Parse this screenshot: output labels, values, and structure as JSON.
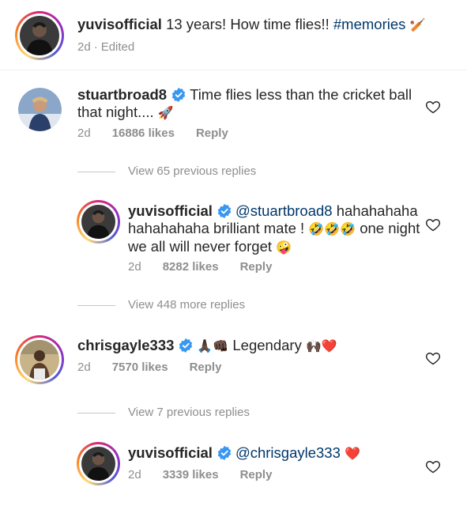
{
  "caption": {
    "username": "yuvisofficial",
    "text": "13 years! How time flies!!",
    "hashtag": "#memories",
    "emoji": "🏏",
    "time": "2d",
    "edited": "Edited"
  },
  "comments": [
    {
      "username": "stuartbroad8",
      "verified": true,
      "text": "Time flies less than the cricket ball that night....",
      "emoji": "🚀",
      "time": "2d",
      "likes": "16886 likes",
      "reply": "Reply"
    },
    {
      "username": "chrisgayle333",
      "verified": true,
      "emoji_lead": "🙏🏿👊🏿",
      "text": "Legendary",
      "emoji_trail": "🙌🏿❤️",
      "time": "2d",
      "likes": "7570 likes",
      "reply": "Reply"
    }
  ],
  "view_replies": {
    "first_previous": "View 65 previous replies",
    "first_more": "View 448 more replies",
    "second_previous": "View 7 previous replies"
  },
  "replies": [
    {
      "username": "yuvisofficial",
      "verified": true,
      "mention": "@stuartbroad8",
      "text_line1": "hahahahaha",
      "text_line2": "hahahahaha brilliant mate !",
      "emoji_mid": "🤣🤣🤣",
      "text_line2b": "one",
      "text_line3": "night we all will never forget",
      "emoji_end": "🤪",
      "time": "2d",
      "likes": "8282 likes",
      "reply": "Reply"
    },
    {
      "username": "yuvisofficial",
      "verified": true,
      "mention": "@chrisgayle333",
      "emoji": "❤️",
      "time": "2d",
      "likes": "3339 likes",
      "reply": "Reply"
    }
  ],
  "colors": {
    "text": "#262626",
    "secondary": "#8e8e8e",
    "link": "#00376b",
    "verified": "#3897f0"
  }
}
